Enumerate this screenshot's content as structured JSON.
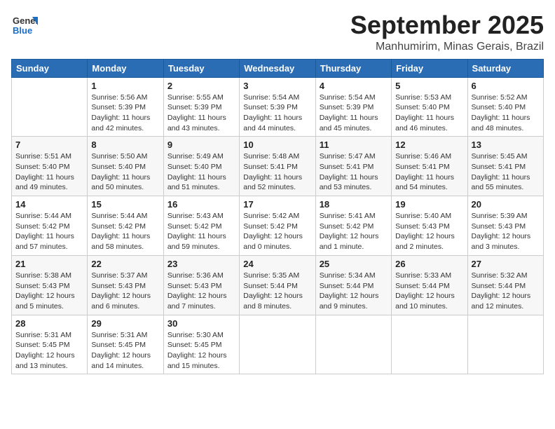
{
  "header": {
    "logo_general": "General",
    "logo_blue": "Blue",
    "month": "September 2025",
    "location": "Manhumirim, Minas Gerais, Brazil"
  },
  "days_of_week": [
    "Sunday",
    "Monday",
    "Tuesday",
    "Wednesday",
    "Thursday",
    "Friday",
    "Saturday"
  ],
  "weeks": [
    [
      {
        "day": "",
        "info": ""
      },
      {
        "day": "1",
        "info": "Sunrise: 5:56 AM\nSunset: 5:39 PM\nDaylight: 11 hours\nand 42 minutes."
      },
      {
        "day": "2",
        "info": "Sunrise: 5:55 AM\nSunset: 5:39 PM\nDaylight: 11 hours\nand 43 minutes."
      },
      {
        "day": "3",
        "info": "Sunrise: 5:54 AM\nSunset: 5:39 PM\nDaylight: 11 hours\nand 44 minutes."
      },
      {
        "day": "4",
        "info": "Sunrise: 5:54 AM\nSunset: 5:39 PM\nDaylight: 11 hours\nand 45 minutes."
      },
      {
        "day": "5",
        "info": "Sunrise: 5:53 AM\nSunset: 5:40 PM\nDaylight: 11 hours\nand 46 minutes."
      },
      {
        "day": "6",
        "info": "Sunrise: 5:52 AM\nSunset: 5:40 PM\nDaylight: 11 hours\nand 48 minutes."
      }
    ],
    [
      {
        "day": "7",
        "info": "Sunrise: 5:51 AM\nSunset: 5:40 PM\nDaylight: 11 hours\nand 49 minutes."
      },
      {
        "day": "8",
        "info": "Sunrise: 5:50 AM\nSunset: 5:40 PM\nDaylight: 11 hours\nand 50 minutes."
      },
      {
        "day": "9",
        "info": "Sunrise: 5:49 AM\nSunset: 5:40 PM\nDaylight: 11 hours\nand 51 minutes."
      },
      {
        "day": "10",
        "info": "Sunrise: 5:48 AM\nSunset: 5:41 PM\nDaylight: 11 hours\nand 52 minutes."
      },
      {
        "day": "11",
        "info": "Sunrise: 5:47 AM\nSunset: 5:41 PM\nDaylight: 11 hours\nand 53 minutes."
      },
      {
        "day": "12",
        "info": "Sunrise: 5:46 AM\nSunset: 5:41 PM\nDaylight: 11 hours\nand 54 minutes."
      },
      {
        "day": "13",
        "info": "Sunrise: 5:45 AM\nSunset: 5:41 PM\nDaylight: 11 hours\nand 55 minutes."
      }
    ],
    [
      {
        "day": "14",
        "info": "Sunrise: 5:44 AM\nSunset: 5:42 PM\nDaylight: 11 hours\nand 57 minutes."
      },
      {
        "day": "15",
        "info": "Sunrise: 5:44 AM\nSunset: 5:42 PM\nDaylight: 11 hours\nand 58 minutes."
      },
      {
        "day": "16",
        "info": "Sunrise: 5:43 AM\nSunset: 5:42 PM\nDaylight: 11 hours\nand 59 minutes."
      },
      {
        "day": "17",
        "info": "Sunrise: 5:42 AM\nSunset: 5:42 PM\nDaylight: 12 hours\nand 0 minutes."
      },
      {
        "day": "18",
        "info": "Sunrise: 5:41 AM\nSunset: 5:42 PM\nDaylight: 12 hours\nand 1 minute."
      },
      {
        "day": "19",
        "info": "Sunrise: 5:40 AM\nSunset: 5:43 PM\nDaylight: 12 hours\nand 2 minutes."
      },
      {
        "day": "20",
        "info": "Sunrise: 5:39 AM\nSunset: 5:43 PM\nDaylight: 12 hours\nand 3 minutes."
      }
    ],
    [
      {
        "day": "21",
        "info": "Sunrise: 5:38 AM\nSunset: 5:43 PM\nDaylight: 12 hours\nand 5 minutes."
      },
      {
        "day": "22",
        "info": "Sunrise: 5:37 AM\nSunset: 5:43 PM\nDaylight: 12 hours\nand 6 minutes."
      },
      {
        "day": "23",
        "info": "Sunrise: 5:36 AM\nSunset: 5:43 PM\nDaylight: 12 hours\nand 7 minutes."
      },
      {
        "day": "24",
        "info": "Sunrise: 5:35 AM\nSunset: 5:44 PM\nDaylight: 12 hours\nand 8 minutes."
      },
      {
        "day": "25",
        "info": "Sunrise: 5:34 AM\nSunset: 5:44 PM\nDaylight: 12 hours\nand 9 minutes."
      },
      {
        "day": "26",
        "info": "Sunrise: 5:33 AM\nSunset: 5:44 PM\nDaylight: 12 hours\nand 10 minutes."
      },
      {
        "day": "27",
        "info": "Sunrise: 5:32 AM\nSunset: 5:44 PM\nDaylight: 12 hours\nand 12 minutes."
      }
    ],
    [
      {
        "day": "28",
        "info": "Sunrise: 5:31 AM\nSunset: 5:45 PM\nDaylight: 12 hours\nand 13 minutes."
      },
      {
        "day": "29",
        "info": "Sunrise: 5:31 AM\nSunset: 5:45 PM\nDaylight: 12 hours\nand 14 minutes."
      },
      {
        "day": "30",
        "info": "Sunrise: 5:30 AM\nSunset: 5:45 PM\nDaylight: 12 hours\nand 15 minutes."
      },
      {
        "day": "",
        "info": ""
      },
      {
        "day": "",
        "info": ""
      },
      {
        "day": "",
        "info": ""
      },
      {
        "day": "",
        "info": ""
      }
    ]
  ]
}
